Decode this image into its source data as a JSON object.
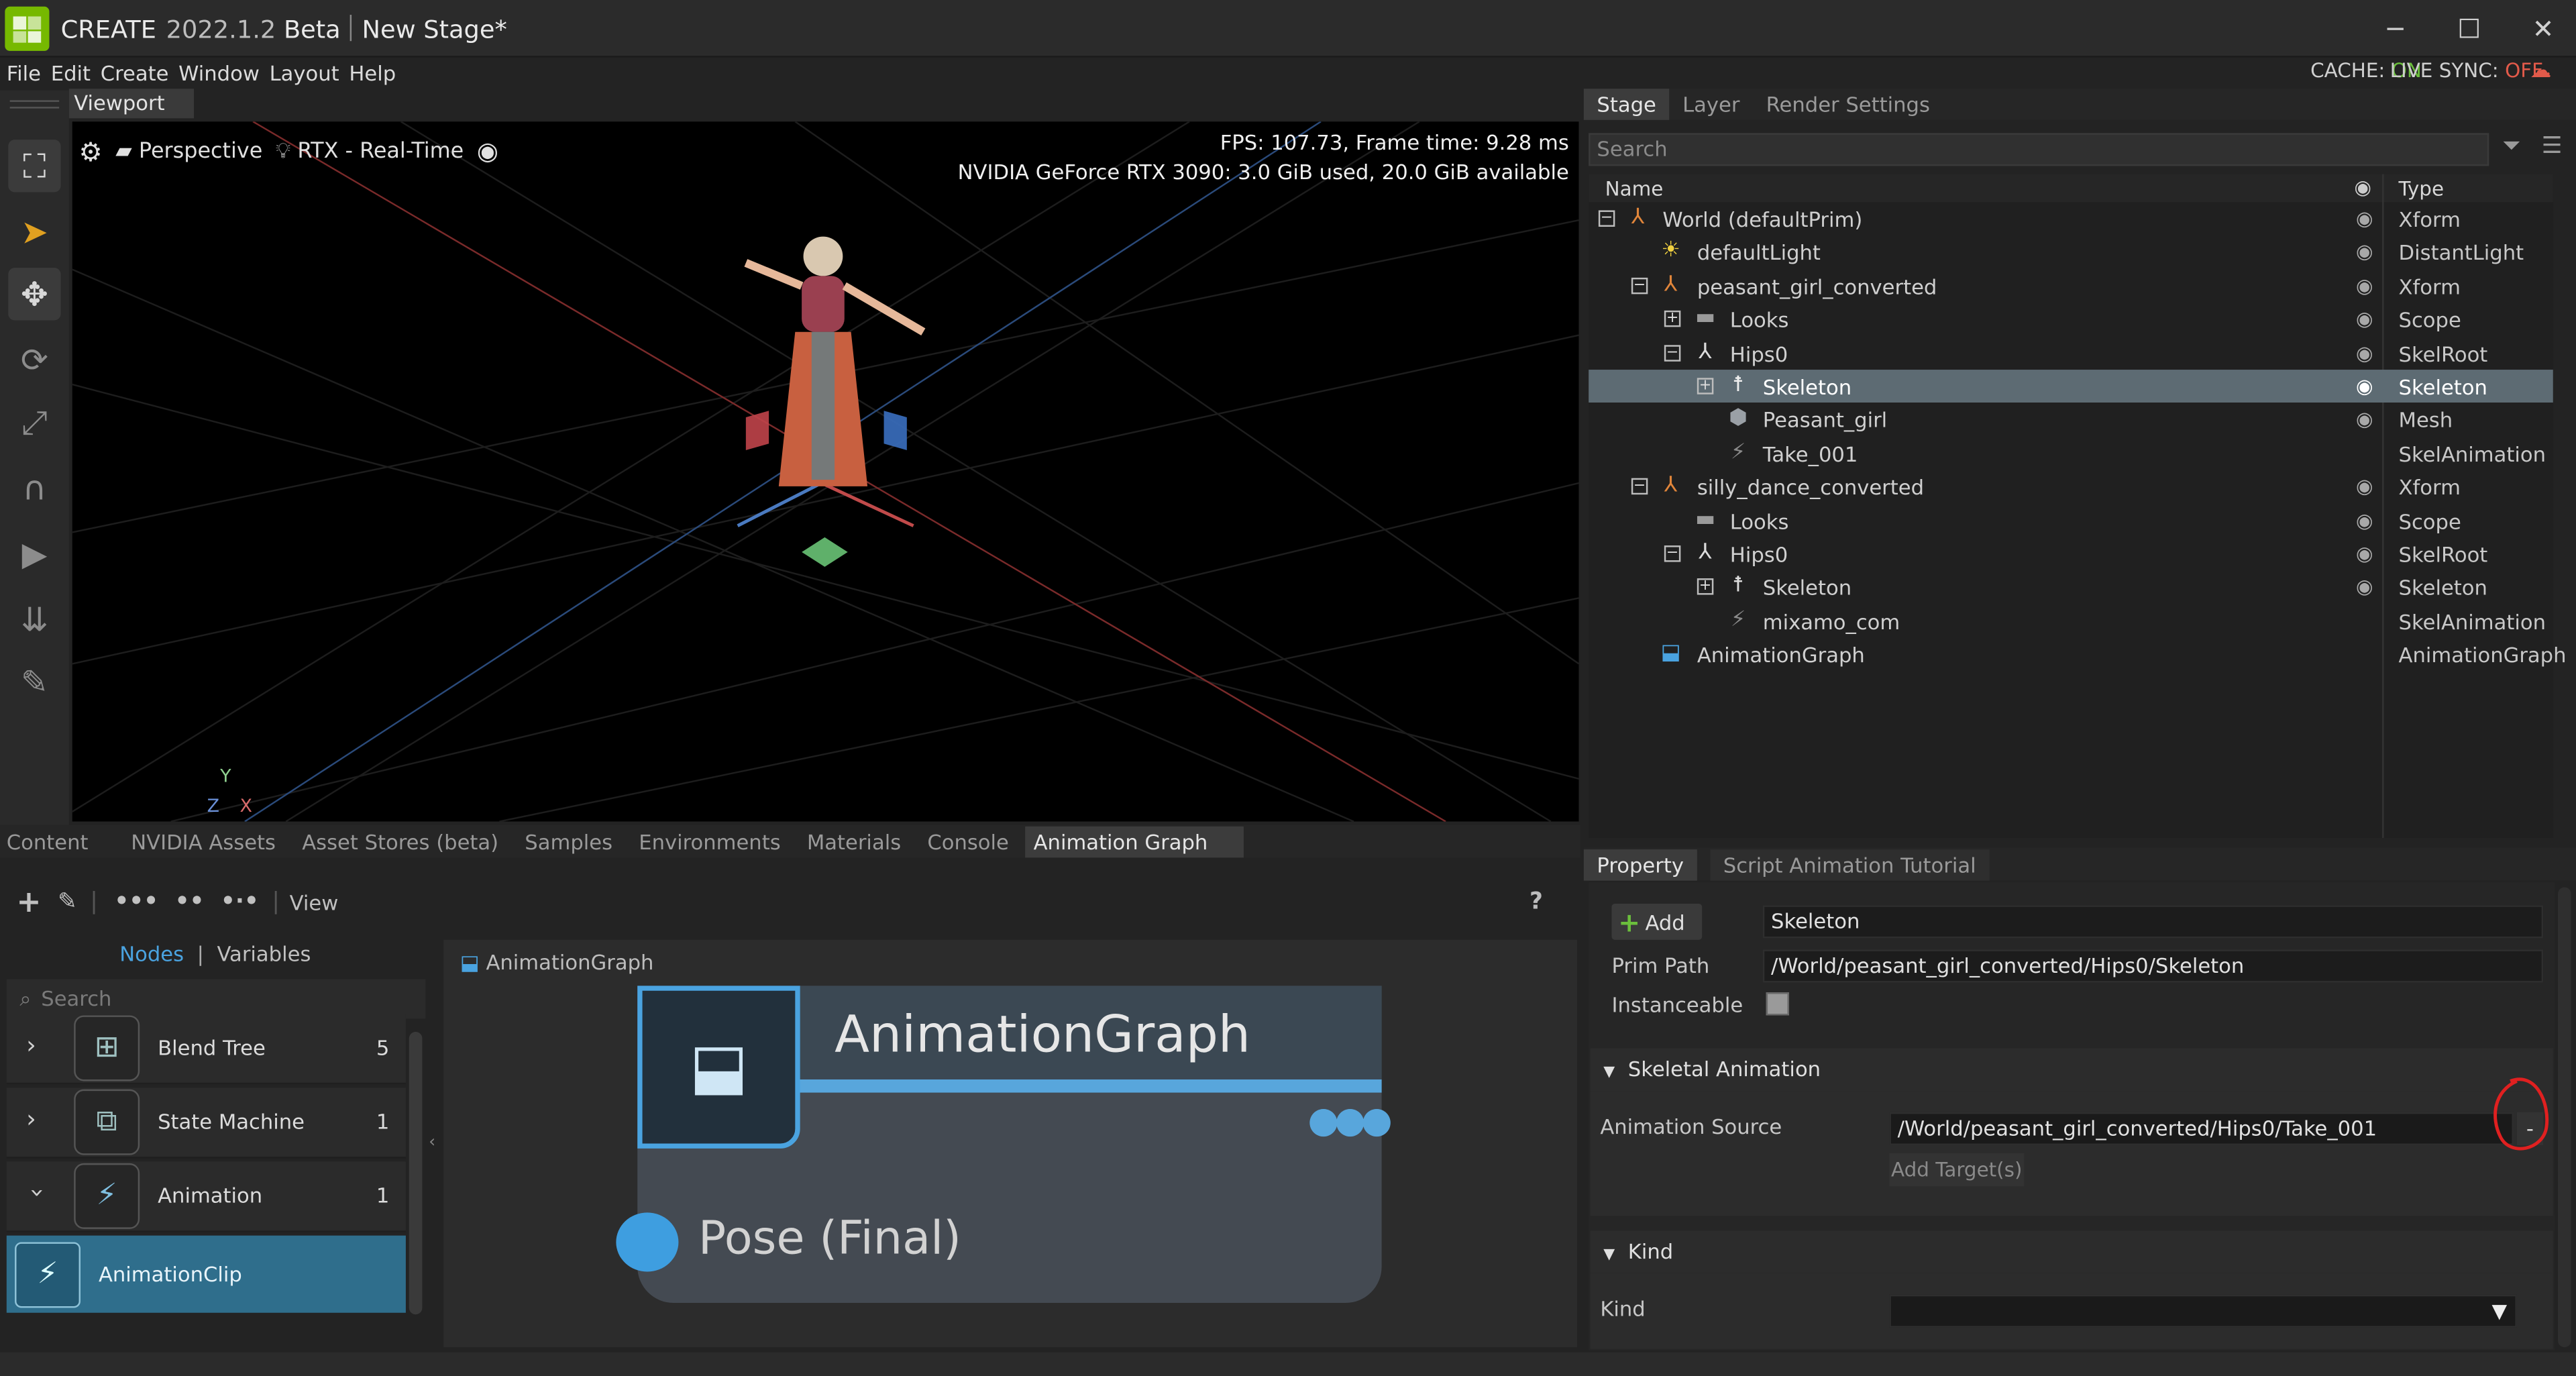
{
  "app": {
    "name": "CREATE",
    "version": "2022.1.2",
    "channel": "Beta",
    "document": "New Stage*"
  },
  "window_controls": {
    "minimize": "─",
    "maximize": "☐",
    "close": "✕"
  },
  "menu": [
    "File",
    "Edit",
    "Create",
    "Window",
    "Layout",
    "Help"
  ],
  "status": {
    "cache_label": "CACHE:",
    "cache_value": "ON",
    "livesync_label": "LIVE SYNC:",
    "livesync_value": "OFF",
    "on_color": "#6bbf3c",
    "off_color": "#e25a4a"
  },
  "viewport": {
    "tab": "Viewport",
    "camera": "Perspective",
    "renderer": "RTX - Real-Time",
    "fps_line": "FPS: 107.73, Frame time: 9.28 ms",
    "gpu_line": "NVIDIA GeForce RTX 3090: 3.0 GiB used,  20.0 GiB available",
    "axis_labels": {
      "y": "Y",
      "z": "Z",
      "x": "X"
    }
  },
  "stage": {
    "tabs": [
      "Stage",
      "Layer",
      "Render Settings"
    ],
    "search_placeholder": "Search",
    "col_name": "Name",
    "col_type": "Type",
    "rows": [
      {
        "name": "World (defaultPrim)",
        "type": "Xform",
        "icon": "xform-icon"
      },
      {
        "name": "defaultLight",
        "type": "DistantLight",
        "icon": "light-icon"
      },
      {
        "name": "peasant_girl_converted",
        "type": "Xform",
        "icon": "xform-icon"
      },
      {
        "name": "Looks",
        "type": "Scope",
        "icon": "folder-icon"
      },
      {
        "name": "Hips0",
        "type": "SkelRoot",
        "icon": "skelroot-icon"
      },
      {
        "name": "Skeleton",
        "type": "Skeleton",
        "icon": "skeleton-icon"
      },
      {
        "name": "Peasant_girl",
        "type": "Mesh",
        "icon": "mesh-icon"
      },
      {
        "name": "Take_001",
        "type": "SkelAnimation",
        "icon": "skelanimation-icon"
      },
      {
        "name": "silly_dance_converted",
        "type": "Xform",
        "icon": "xform-icon"
      },
      {
        "name": "Looks",
        "type": "Scope",
        "icon": "folder-icon"
      },
      {
        "name": "Hips0",
        "type": "SkelRoot",
        "icon": "skelroot-icon"
      },
      {
        "name": "Skeleton",
        "type": "Skeleton",
        "icon": "skeleton-icon"
      },
      {
        "name": "mixamo_com",
        "type": "SkelAnimation",
        "icon": "skelanimation-icon"
      },
      {
        "name": "AnimationGraph",
        "type": "AnimationGraph",
        "icon": "animationgraph-icon"
      }
    ]
  },
  "property": {
    "tabs": [
      "Property",
      "Script Animation Tutorial"
    ],
    "add_label": "Add",
    "name_value": "Skeleton",
    "prim_path_label": "Prim Path",
    "prim_path_value": "/World/peasant_girl_converted/Hips0/Skeleton",
    "instanceable_label": "Instanceable",
    "skeletal_section": "Skeletal Animation",
    "anim_source_label": "Animation Source",
    "anim_source_value": "/World/peasant_girl_converted/Hips0/Take_001",
    "remove_label": "-",
    "add_targets_label": "Add Target(s)",
    "kind_section": "Kind",
    "kind_label": "Kind",
    "kind_value": ""
  },
  "bottom_tabs": [
    "Content",
    "NVIDIA Assets",
    "Asset Stores (beta)",
    "Samples",
    "Environments",
    "Materials",
    "Console",
    "Animation Graph"
  ],
  "animation_graph": {
    "view_label": "View",
    "help": "?",
    "nodes_tab": "Nodes",
    "variables_tab": "Variables",
    "search_placeholder": "Search",
    "node_categories": [
      {
        "label": "Blend Tree",
        "count": "5"
      },
      {
        "label": "State Machine",
        "count": "1"
      },
      {
        "label": "Animation",
        "count": "1"
      }
    ],
    "selected_node": "AnimationClip",
    "breadcrumb": "AnimationGraph",
    "graph_node_title": "AnimationGraph",
    "graph_node_port": "Pose (Final)"
  }
}
